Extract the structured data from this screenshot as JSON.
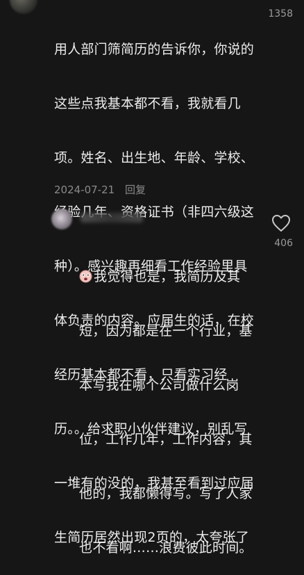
{
  "comment1": {
    "lines": [
      "用人部门筛简历的告诉你，你说的",
      "这些点我基本都不看，我就看几",
      "项。姓名、出生地、年龄、学校、",
      "经验几年、资格证书（非四六级这",
      "种）。感兴趣再细看工作经验里具",
      "体负责的内容。应届生的话，在校",
      "经历基本都不看，只看实习经",
      "历。。给求职小伙伴建议，别乱写",
      "一堆有的没的，我甚至看到过应届",
      "生简历居然出现2页的，太夸张了"
    ],
    "date": "2024-07-21",
    "reply_label": "回复",
    "likes": "1358"
  },
  "comment2": {
    "lines": [
      "我觉得也是，我简历及其",
      "短，因为都是在一个行业，基",
      "本写我在哪个公司做什么岗",
      "位，工作几年，工作内容，其",
      "他的，我都懒得写。写了人家",
      "也不看啊……浪费彼此时间。"
    ],
    "likes": "406",
    "emoji_icon": "shocked-face-emoji"
  }
}
